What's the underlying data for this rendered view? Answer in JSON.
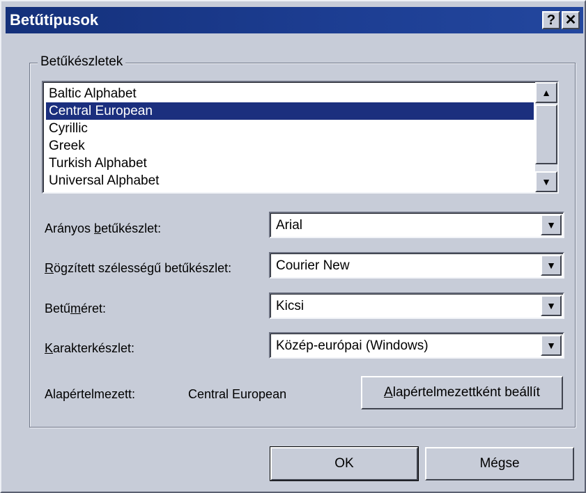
{
  "window": {
    "title": "Betűtípusok",
    "help_glyph": "?",
    "close_glyph": "✕"
  },
  "charsets_group": {
    "legend": "Betűkészletek",
    "items": [
      {
        "label": "Baltic Alphabet",
        "selected": false
      },
      {
        "label": "Central European",
        "selected": true
      },
      {
        "label": "Cyrillic",
        "selected": false
      },
      {
        "label": "Greek",
        "selected": false
      },
      {
        "label": "Turkish Alphabet",
        "selected": false
      },
      {
        "label": "Universal Alphabet",
        "selected": false
      }
    ],
    "scroll_up_glyph": "▲",
    "scroll_down_glyph": "▼"
  },
  "fields": {
    "proportional": {
      "label_pre": "Arányos ",
      "label_ul": "b",
      "label_post": "etűkészlet:",
      "value": "Arial"
    },
    "fixed_width": {
      "label_pre": "",
      "label_ul": "R",
      "label_post": "ögzített szélességű betűkészlet:",
      "value": "Courier New"
    },
    "font_size": {
      "label_pre": "Betű",
      "label_ul": "m",
      "label_post": "éret:",
      "value": "Kicsi"
    },
    "charset": {
      "label_pre": "",
      "label_ul": "K",
      "label_post": "arakterkészlet:",
      "value": "Közép-európai (Windows)"
    },
    "dropdown_glyph": "▼"
  },
  "default": {
    "label": "Alapértelmezett:",
    "value": "Central European",
    "button_ul": "A",
    "button_post": "lapértelmezettként beállít"
  },
  "buttons": {
    "ok": "OK",
    "cancel": "Mégse"
  },
  "colors": {
    "title_bar": "#1b2f7e",
    "selection": "#1b2f7e",
    "face": "#c7ccd8"
  }
}
